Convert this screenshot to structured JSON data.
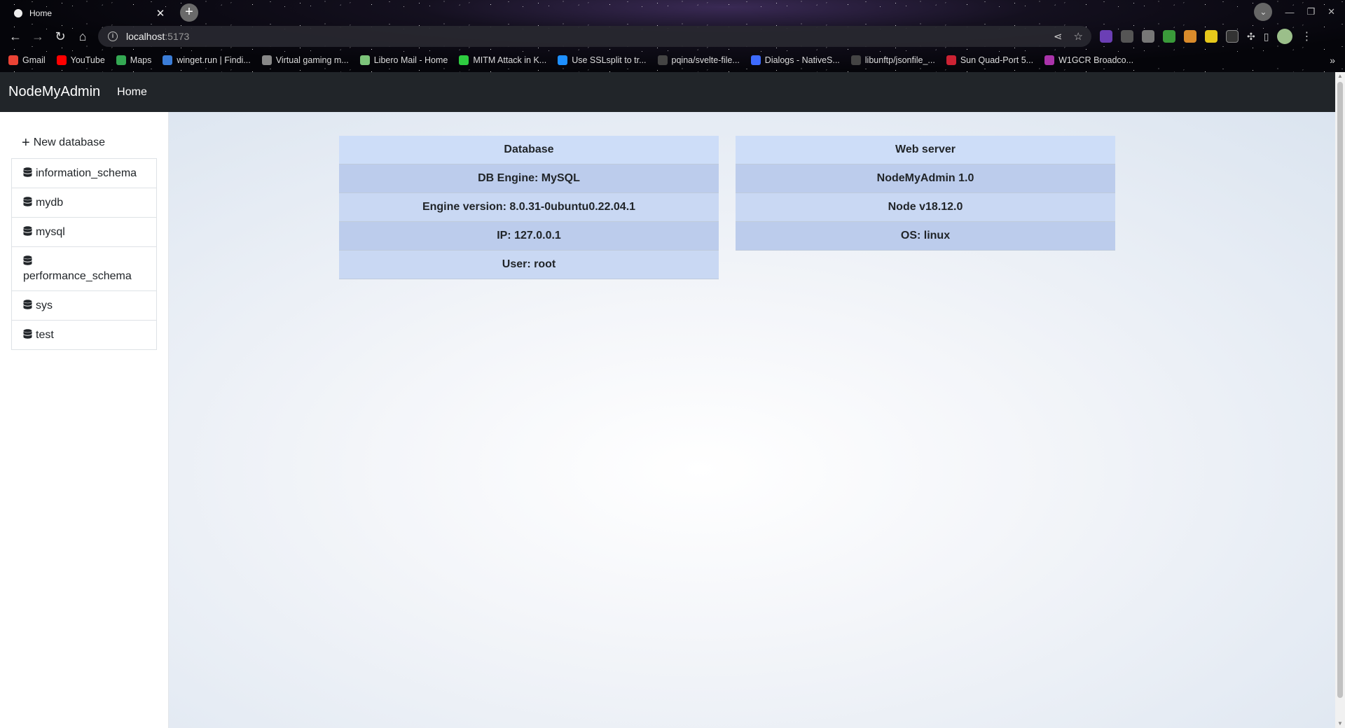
{
  "browser": {
    "tab_title": "Home",
    "new_tab_symbol": "+",
    "url_host": "localhost",
    "url_port": ":5173",
    "bookmarks": [
      {
        "label": "Gmail",
        "color": "#ea4335"
      },
      {
        "label": "YouTube",
        "color": "#ff0000"
      },
      {
        "label": "Maps",
        "color": "#34a853"
      },
      {
        "label": "winget.run | Findi...",
        "color": "#3b7dd8"
      },
      {
        "label": "Virtual gaming m...",
        "color": "#888888"
      },
      {
        "label": "Libero Mail - Home",
        "color": "#7cc47a"
      },
      {
        "label": "MITM Attack in K...",
        "color": "#2ecc40"
      },
      {
        "label": "Use SSLsplit to tr...",
        "color": "#1e90ff"
      },
      {
        "label": "pqina/svelte-file...",
        "color": "#444444"
      },
      {
        "label": "Dialogs - NativeS...",
        "color": "#3d6bff"
      },
      {
        "label": "libunftp/jsonfile_...",
        "color": "#444444"
      },
      {
        "label": "Sun Quad-Port 5...",
        "color": "#cc2233"
      },
      {
        "label": "W1GCR Broadco...",
        "color": "#aa33aa"
      }
    ]
  },
  "navbar": {
    "brand": "NodeMyAdmin",
    "home": "Home"
  },
  "sidebar": {
    "new_database": "New database",
    "databases": [
      "information_schema",
      "mydb",
      "mysql",
      "performance_schema",
      "sys",
      "test"
    ]
  },
  "database_card": {
    "header": "Database",
    "rows": [
      "DB Engine: MySQL",
      "Engine version: 8.0.31-0ubuntu0.22.04.1",
      "IP: 127.0.0.1",
      "User: root"
    ]
  },
  "webserver_card": {
    "header": "Web server",
    "rows": [
      "NodeMyAdmin 1.0",
      "Node v18.12.0",
      "OS: linux"
    ]
  },
  "colors": {
    "navbar_bg": "#212529",
    "row_light": "#c9d8f3",
    "row_dark": "#bcccec"
  }
}
